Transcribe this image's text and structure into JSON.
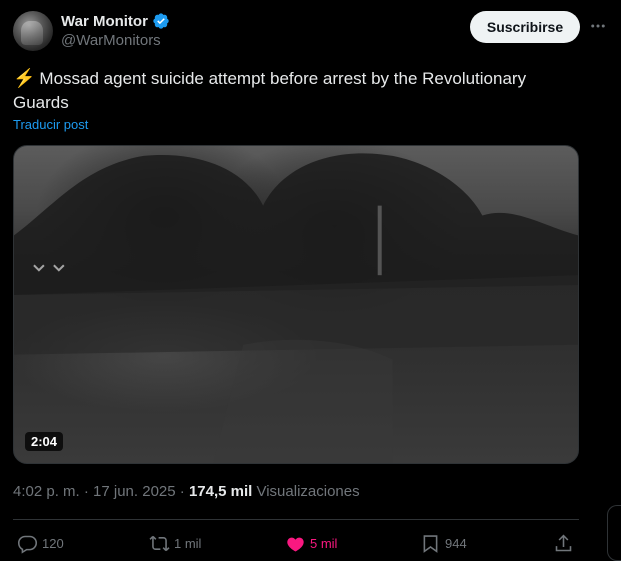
{
  "author": {
    "display_name": "War Monitor",
    "handle": "@WarMonitors"
  },
  "subscribe_label": "Suscribirse",
  "tweet": {
    "emoji": "⚡",
    "text": "Mossad agent suicide attempt before arrest by the Revolutionary Guards",
    "translate_label": "Traducir post"
  },
  "media": {
    "duration": "2:04"
  },
  "meta": {
    "time_date": "4:02 p. m. · 17 jun. 2025 · ",
    "views_count": "174,5 mil",
    "views_label": " Visualizaciones"
  },
  "actions": {
    "replies": "120",
    "reposts": "1 mil",
    "likes": "5 mil",
    "bookmarks": "944"
  },
  "colors": {
    "verified": "#1d9bf0",
    "like_active": "#f91880",
    "link": "#1d9bf0"
  }
}
